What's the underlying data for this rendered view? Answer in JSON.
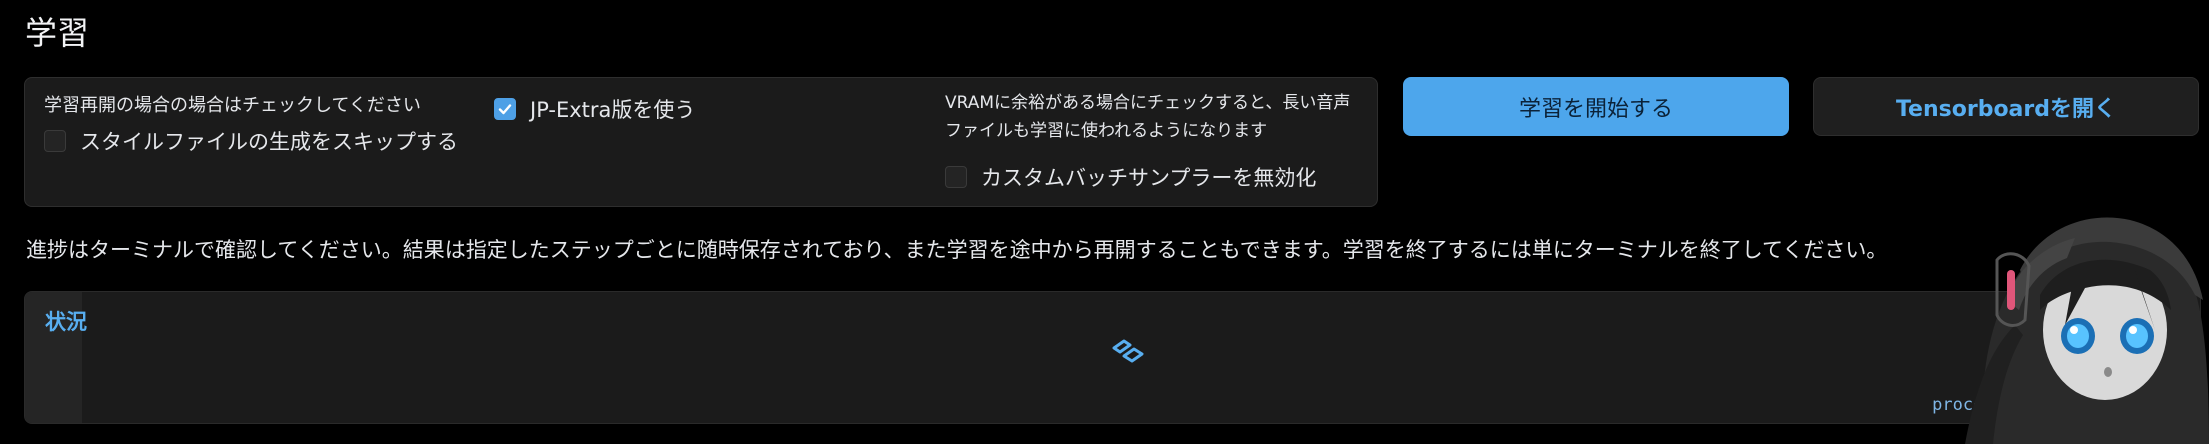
{
  "page": {
    "title": "学習"
  },
  "options": {
    "resume_label": "学習再開の場合の場合はチェックしてください",
    "skip_style": {
      "label": "スタイルファイルの生成をスキップする",
      "checked": false
    },
    "jp_extra": {
      "label": "JP-Extra版を使う",
      "checked": true
    },
    "vram_info": "VRAMに余裕がある場合にチェックすると、長い音声ファイルも学習に使われるようになります",
    "disable_batch_sampler": {
      "label": "カスタムバッチサンプラーを無効化",
      "checked": false
    }
  },
  "buttons": {
    "start_training": "学習を開始する",
    "open_tensorboard": "Tensorboardを開く"
  },
  "notice": "進捗はターミナルで確認してください。結果は指定したステップごとに随時保存されており、また学習を途中から再開することもできます。学習を終了するには単にターミナルを終了してください。",
  "status": {
    "label": "状況",
    "progress": "processing | 41.2/1622.3s",
    "spinner_icon": "loading-spinner-icon"
  },
  "colors": {
    "accent": "#4da6ec",
    "link": "#58aef0",
    "panel_bg": "#1b1b1b",
    "page_bg": "#000000"
  }
}
